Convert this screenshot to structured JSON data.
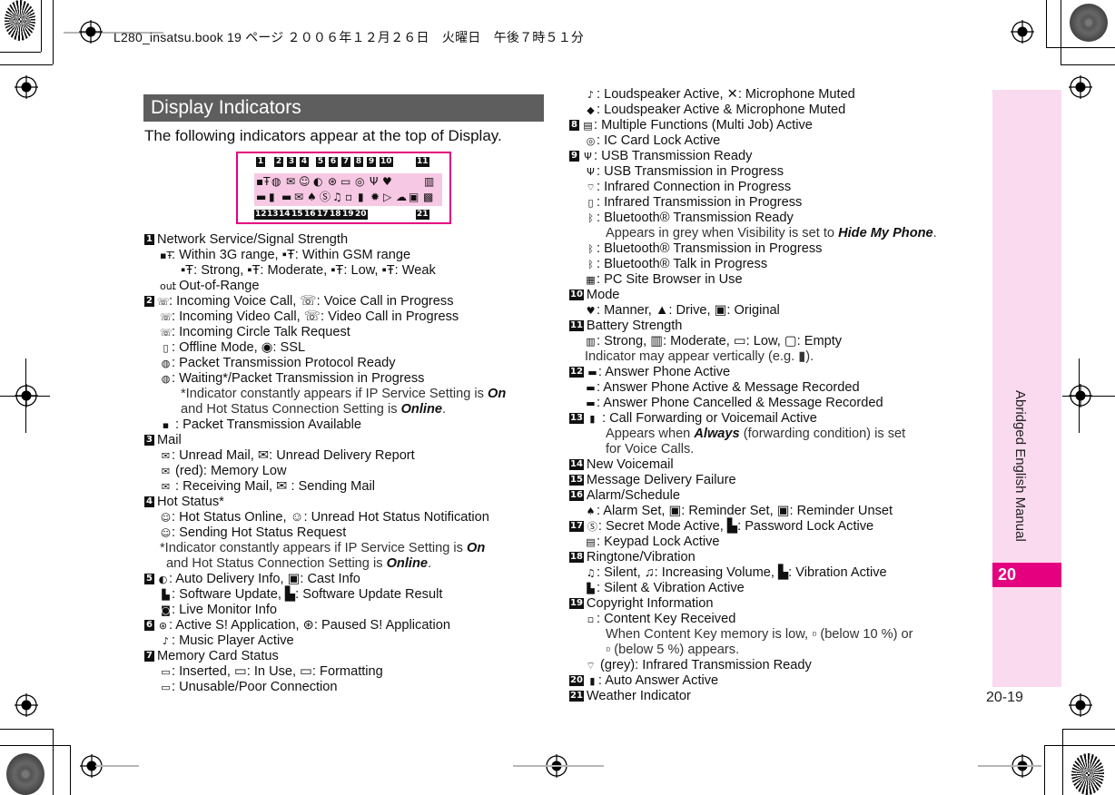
{
  "print_header": "L280_insatsu.book  19 ページ  ２００６年１２月２６日　火曜日　午後７時５１分",
  "section_title": "Display Indicators",
  "intro": "The following indicators appear at the top of Display.",
  "diagram": {
    "top_numbers": [
      "1",
      "2",
      "3",
      "4",
      "5",
      "6",
      "7",
      "8",
      "9",
      "10",
      "11"
    ],
    "bottom_numbers": [
      "12",
      "13",
      "14",
      "15",
      "16",
      "17",
      "18",
      "19",
      "20",
      "21"
    ],
    "top_icons": [
      "signal",
      "globe",
      "mail",
      "hot-status",
      "auto-delivery",
      "game",
      "memory-card",
      "ic-lock",
      "usb",
      "manner",
      "battery"
    ],
    "bottom_icons": [
      "answer-phone",
      "call-forward",
      "voicemail",
      "mail-fail",
      "alarm",
      "secret",
      "ringtone",
      "drm",
      "auto-answer",
      "sun",
      "play",
      "cloud",
      "calendar",
      "weather"
    ]
  },
  "left_column": [
    {
      "type": "heading",
      "num": "1",
      "text": "Network Service/Signal Strength"
    },
    {
      "type": "item",
      "icon": "▪Ŧ",
      "text": ": Within 3G range, ▪Ŧ: Within GSM range"
    },
    {
      "type": "sub",
      "text": "▪Ŧ: Strong, ▪Ŧ: Moderate, ▪Ŧ: Low, ▪Ŧ: Weak"
    },
    {
      "type": "item",
      "icon": "out",
      "text": ": Out-of-Range"
    },
    {
      "type": "heading-item",
      "num": "2",
      "icon": "☏",
      "text": ": Incoming Voice Call, ☏: Voice Call in Progress"
    },
    {
      "type": "item",
      "icon": "☏",
      "text": ": Incoming Video Call, ☏: Video Call in Progress"
    },
    {
      "type": "item",
      "icon": "☏",
      "text": ": Incoming Circle Talk Request"
    },
    {
      "type": "item",
      "icon": "▯",
      "text": ": Offline Mode, ◉: SSL"
    },
    {
      "type": "item",
      "icon": "◍",
      "text": ": Packet Transmission Protocol Ready"
    },
    {
      "type": "item",
      "icon": "◍",
      "text": ": Waiting*/Packet Transmission in Progress"
    },
    {
      "type": "note",
      "text": "*Indicator constantly appears if IP Service Setting is ",
      "em1": "On"
    },
    {
      "type": "note2",
      "text": "and Hot Status Connection Setting is ",
      "em1": "Online",
      "tail": "."
    },
    {
      "type": "item",
      "icon": "▪",
      "text": " : Packet Transmission Available"
    },
    {
      "type": "heading",
      "num": "3",
      "text": "Mail"
    },
    {
      "type": "item",
      "icon": "✉",
      "text": ": Unread Mail, ✉: Unread Delivery Report"
    },
    {
      "type": "item",
      "icon": "✉",
      "text": " (red): Memory Low"
    },
    {
      "type": "item",
      "icon": "✉",
      "text": " : Receiving Mail, ✉ : Sending Mail"
    },
    {
      "type": "heading",
      "num": "4",
      "text": "Hot Status*"
    },
    {
      "type": "item",
      "icon": "☺",
      "text": ": Hot Status Online, ☺: Unread Hot Status Notification"
    },
    {
      "type": "item",
      "icon": "☺",
      "text": ": Sending Hot Status Request"
    },
    {
      "type": "note3",
      "text": "*Indicator constantly appears if IP Service Setting is ",
      "em1": "On"
    },
    {
      "type": "note4",
      "text": "and Hot Status Connection Setting is ",
      "em1": "Online",
      "tail": "."
    },
    {
      "type": "heading-item",
      "num": "5",
      "icon": "◐",
      "text": ": Auto Delivery Info, ▣: Cast Info"
    },
    {
      "type": "item",
      "icon": "▙",
      "text": ": Software Update, ▙: Software Update Result"
    },
    {
      "type": "item",
      "icon": "◙",
      "text": ": Live Monitor Info"
    },
    {
      "type": "heading-item",
      "num": "6",
      "icon": "⊛",
      "text": ": Active S! Application, ⊛: Paused S! Application"
    },
    {
      "type": "item",
      "icon": "♪",
      "text": ": Music Player Active"
    },
    {
      "type": "heading",
      "num": "7",
      "text": "Memory Card Status"
    },
    {
      "type": "item",
      "icon": "▭",
      "text": ": Inserted, ▭: In Use, ▭: Formatting"
    },
    {
      "type": "item",
      "icon": "▭",
      "text": ": Unusable/Poor Connection"
    }
  ],
  "right_column": [
    {
      "type": "item",
      "icon": "♪",
      "text": ": Loudspeaker Active, ✕: Microphone Muted"
    },
    {
      "type": "item",
      "icon": "◆",
      "text": ": Loudspeaker Active & Microphone Muted"
    },
    {
      "type": "heading-item",
      "num": "8",
      "icon": "▤",
      "text": ": Multiple Functions (Multi Job) Active"
    },
    {
      "type": "item",
      "icon": "◎",
      "text": ": IC Card Lock Active"
    },
    {
      "type": "heading-item",
      "num": "9",
      "icon": "Ψ",
      "text": ": USB Transmission Ready"
    },
    {
      "type": "item",
      "icon": "Ψ",
      "text": ": USB Transmission in Progress"
    },
    {
      "type": "item",
      "icon": "⌔",
      "text": ": Infrared Connection in Progress"
    },
    {
      "type": "item",
      "icon": "▯",
      "text": ": Infrared Transmission in Progress"
    },
    {
      "type": "item",
      "icon": "ᛒ",
      "text": ": Bluetooth® Transmission Ready"
    },
    {
      "type": "note",
      "text": "Appears in grey when Visibility is set to ",
      "em1": "Hide My Phone",
      "tail": "."
    },
    {
      "type": "item",
      "icon": "ᛒ",
      "text": ": Bluetooth® Transmission in Progress"
    },
    {
      "type": "item",
      "icon": "ᛒ",
      "text": ": Bluetooth® Talk in Progress"
    },
    {
      "type": "item",
      "icon": "▦",
      "text": ": PC Site Browser in Use"
    },
    {
      "type": "heading",
      "num": "10",
      "text": "Mode"
    },
    {
      "type": "item",
      "icon": "♥",
      "text": ": Manner, ▲: Drive, ▣: Original"
    },
    {
      "type": "heading",
      "num": "11",
      "text": "Battery Strength"
    },
    {
      "type": "item",
      "icon": "▥",
      "text": ": Strong, ▥: Moderate, ▭: Low, ▢: Empty"
    },
    {
      "type": "plain",
      "text": "Indicator may appear vertically (e.g. ▮)."
    },
    {
      "type": "heading-item",
      "num": "12",
      "icon": "▬",
      "text": ": Answer Phone Active"
    },
    {
      "type": "item",
      "icon": "▬",
      "text": ": Answer Phone Active & Message Recorded"
    },
    {
      "type": "item",
      "icon": "▬",
      "text": ": Answer Phone Cancelled & Message Recorded"
    },
    {
      "type": "heading-item",
      "num": "13",
      "icon": "▮",
      "text": " : Call Forwarding or Voicemail Active"
    },
    {
      "type": "note",
      "text": "Appears when ",
      "em1": "Always",
      "tail": " (forwarding condition) is set"
    },
    {
      "type": "note",
      "text": "for Voice Calls."
    },
    {
      "type": "heading",
      "num": "14",
      "text": "New Voicemail"
    },
    {
      "type": "heading",
      "num": "15",
      "text": "Message Delivery Failure"
    },
    {
      "type": "heading",
      "num": "16",
      "text": "Alarm/Schedule"
    },
    {
      "type": "item",
      "icon": "♠",
      "text": ": Alarm Set, ▣: Reminder Set, ▣: Reminder Unset"
    },
    {
      "type": "heading-item",
      "num": "17",
      "icon": "Ⓢ",
      "text": ": Secret Mode Active, ▙: Password Lock Active"
    },
    {
      "type": "item",
      "icon": "▤",
      "text": ": Keypad Lock Active"
    },
    {
      "type": "heading",
      "num": "18",
      "text": "Ringtone/Vibration"
    },
    {
      "type": "item",
      "icon": "♫",
      "text": ": Silent, ♫: Increasing Volume, ▙: Vibration Active"
    },
    {
      "type": "item",
      "icon": "▙",
      "text": ": Silent & Vibration Active"
    },
    {
      "type": "heading",
      "num": "19",
      "text": "Copyright Information"
    },
    {
      "type": "item",
      "icon": "▫",
      "text": ": Content Key Received"
    },
    {
      "type": "note",
      "text": "When Content Key memory is low, ▫ (below 10 %) or"
    },
    {
      "type": "note",
      "text": "▫ (below 5 %) appears."
    },
    {
      "type": "item",
      "icon": "⌔",
      "text": " (grey): Infrared Transmission Ready"
    },
    {
      "type": "heading-item",
      "num": "20",
      "icon": "▮",
      "text": ": Auto Answer Active"
    },
    {
      "type": "heading",
      "num": "21",
      "text": "Weather Indicator"
    }
  ],
  "side_tab": {
    "label": "Abridged English Manual",
    "chapter": "20"
  },
  "page_number": "20-19",
  "colors": {
    "accent": "#e4007f",
    "tab_bg": "#fadaee",
    "title_bar": "#5e5e5e",
    "diagram_strip": "#f7c8e3"
  }
}
